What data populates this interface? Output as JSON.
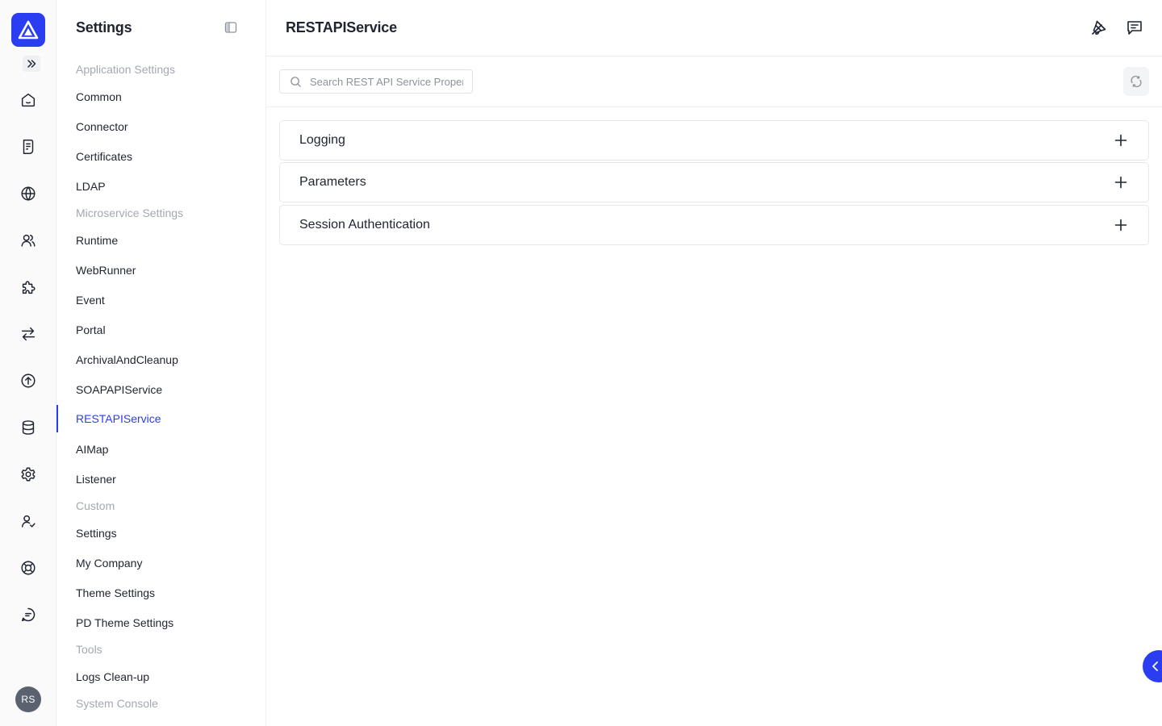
{
  "rail": {
    "avatar_initials": "RS",
    "icons": [
      "home-icon",
      "document-icon",
      "globe-icon",
      "users-icon",
      "puzzle-icon",
      "transfer-icon",
      "upload-icon",
      "database-icon",
      "gear-icon",
      "user-check-icon",
      "lifebuoy-icon",
      "chat-icon"
    ]
  },
  "sidebar": {
    "title": "Settings",
    "groups": [
      {
        "label": "Application Settings",
        "items": [
          "Common",
          "Connector",
          "Certificates",
          "LDAP"
        ]
      },
      {
        "label": "Microservice Settings",
        "items": [
          "Runtime",
          "WebRunner",
          "Event",
          "Portal",
          "ArchivalAndCleanup",
          "SOAPAPIService",
          "RESTAPIService",
          "AIMap",
          "Listener"
        ]
      },
      {
        "label": "Custom",
        "items": [
          "Settings",
          "My Company",
          "Theme Settings",
          "PD Theme Settings"
        ]
      },
      {
        "label": "Tools",
        "items": [
          "Logs Clean-up"
        ]
      },
      {
        "label": "System Console",
        "items": []
      }
    ],
    "active_item": "RESTAPIService"
  },
  "header": {
    "title": "RESTAPIService"
  },
  "search": {
    "placeholder": "Search REST API Service Properties",
    "value": ""
  },
  "panels": [
    "Logging",
    "Parameters",
    "Session Authentication"
  ],
  "colors": {
    "accent": "#2a3df0",
    "muted_text": "#a3a8b2",
    "border": "#e6e8ec"
  }
}
